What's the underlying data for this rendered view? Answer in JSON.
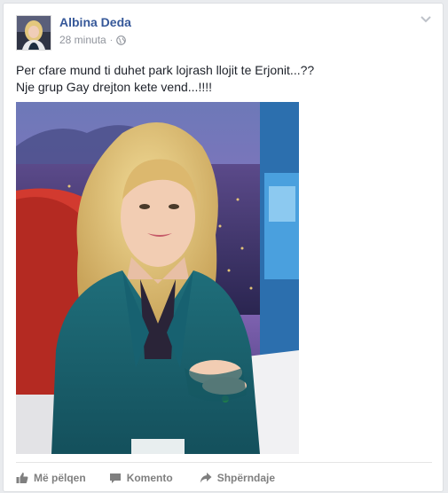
{
  "post": {
    "author": "Albina Deda",
    "time": "28 minuta",
    "separator": "·",
    "text_lines": [
      "Per cfare mund ti duhet park lojrash llojit te Erjonit...??",
      "Nje grup Gay drejton kete vend...!!!!"
    ]
  },
  "actions": {
    "like": "Më pëlqen",
    "comment": "Komento",
    "share": "Shpërndaje"
  },
  "colors": {
    "author_link": "#365899",
    "meta": "#90949c",
    "action": "#7f7f7f"
  },
  "icons": [
    "globe-icon",
    "chevron-down-icon",
    "thumbs-up-icon",
    "comment-icon",
    "share-icon"
  ]
}
